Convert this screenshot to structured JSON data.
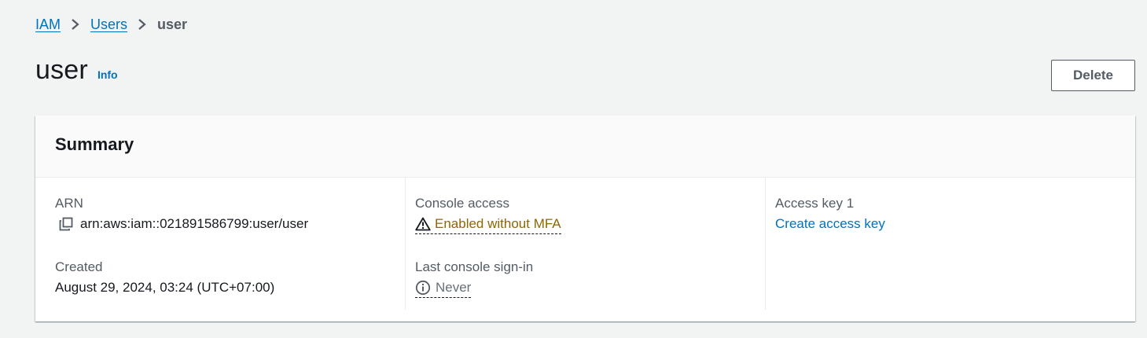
{
  "breadcrumb": {
    "items": [
      {
        "label": "IAM"
      },
      {
        "label": "Users"
      },
      {
        "label": "user"
      }
    ]
  },
  "header": {
    "title": "user",
    "info_label": "Info",
    "delete_label": "Delete"
  },
  "summary": {
    "title": "Summary",
    "arn": {
      "label": "ARN",
      "value": "arn:aws:iam::021891586799:user/user",
      "icon": "copy-icon"
    },
    "created": {
      "label": "Created",
      "value": "August 29, 2024, 03:24 (UTC+07:00)"
    },
    "console_access": {
      "label": "Console access",
      "value": "Enabled without MFA",
      "icon": "warning-icon",
      "color": "#8d6605"
    },
    "last_sign_in": {
      "label": "Last console sign-in",
      "value": "Never",
      "icon": "info-circle-icon"
    },
    "access_key": {
      "label": "Access key 1",
      "link": "Create access key"
    }
  },
  "colors": {
    "link": "#0073bb",
    "background": "#f2f3f3",
    "warning": "#8d6605"
  }
}
